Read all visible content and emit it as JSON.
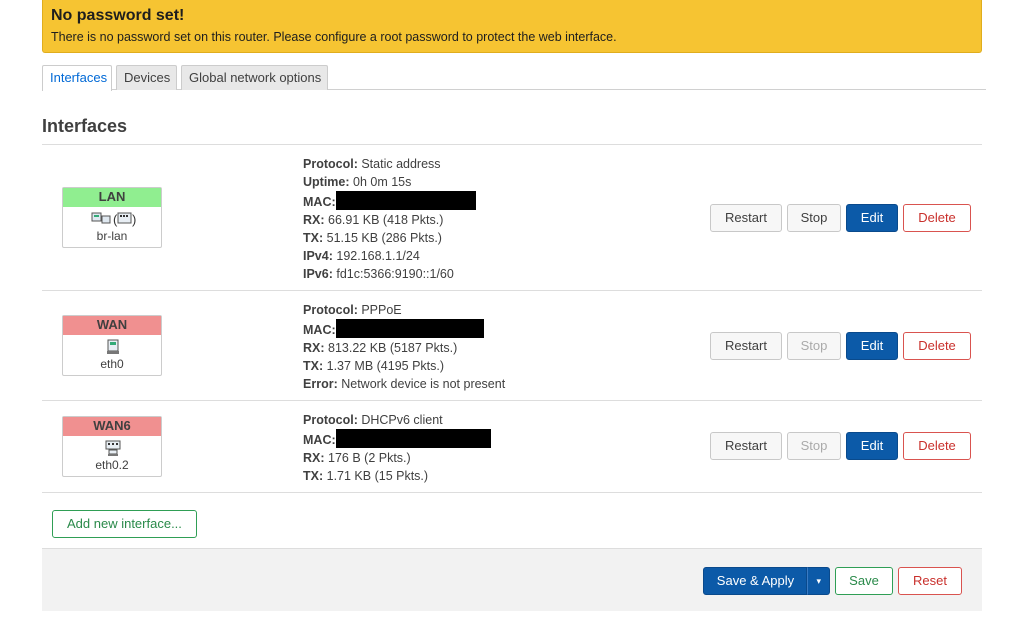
{
  "banner": {
    "title": "No password set!",
    "text": "There is no password set on this router. Please configure a root password to protect the web interface."
  },
  "tabs": [
    {
      "label": "Interfaces",
      "active": true
    },
    {
      "label": "Devices",
      "active": false
    },
    {
      "label": "Global network options",
      "active": false
    }
  ],
  "section_title": "Interfaces",
  "interfaces": [
    {
      "name": "LAN",
      "color": "#90ee90",
      "device": "br-lan",
      "icons": "bridge-icon",
      "info": [
        {
          "label": "Protocol:",
          "value": "Static address"
        },
        {
          "label": "Uptime:",
          "value": "0h 0m 15s"
        },
        {
          "label": "MAC:",
          "value": ""
        },
        {
          "label": "RX:",
          "value": "66.91 KB (418 Pkts.)"
        },
        {
          "label": "TX:",
          "value": "51.15 KB (286 Pkts.)"
        },
        {
          "label": "IPv4:",
          "value": "192.168.1.1/24"
        },
        {
          "label": "IPv6:",
          "value": "fd1c:5366:9190::1/60"
        }
      ],
      "stop_enabled": true
    },
    {
      "name": "WAN",
      "color": "#f09090",
      "device": "eth0",
      "icons": "ethernet-port-icon",
      "info": [
        {
          "label": "Protocol:",
          "value": "PPPoE"
        },
        {
          "label": "MAC:",
          "value": ""
        },
        {
          "label": "RX:",
          "value": "813.22 KB (5187 Pkts.)"
        },
        {
          "label": "TX:",
          "value": "1.37 MB (4195 Pkts.)"
        },
        {
          "label": "Error:",
          "value": "Network device is not present"
        }
      ],
      "stop_enabled": false
    },
    {
      "name": "WAN6",
      "color": "#f09090",
      "device": "eth0.2",
      "icons": "vlan-icon",
      "info": [
        {
          "label": "Protocol:",
          "value": "DHCPv6 client"
        },
        {
          "label": "MAC:",
          "value": ""
        },
        {
          "label": "RX:",
          "value": "176 B (2 Pkts.)"
        },
        {
          "label": "TX:",
          "value": "1.71 KB (15 Pkts.)"
        }
      ],
      "stop_enabled": false
    }
  ],
  "row_buttons": {
    "restart": "Restart",
    "stop": "Stop",
    "edit": "Edit",
    "delete": "Delete"
  },
  "add_button": "Add new interface...",
  "footer": {
    "save_apply": "Save & Apply",
    "caret": "▾",
    "save": "Save",
    "reset": "Reset"
  }
}
